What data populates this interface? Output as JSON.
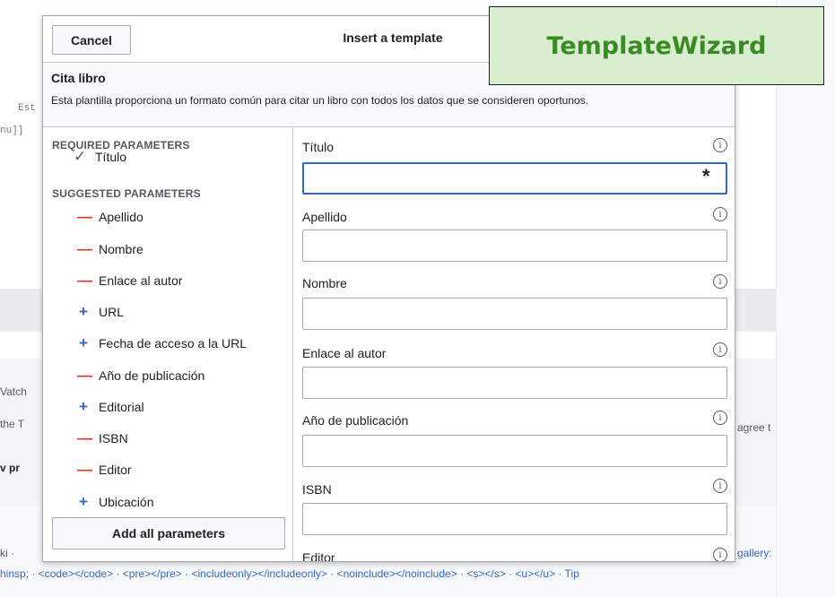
{
  "background": {
    "snippets": [
      {
        "text": "Est",
        "mono": true
      },
      {
        "text": "nu]]",
        "mono": true
      },
      {
        "text": "Vatch"
      },
      {
        "text": "the T"
      },
      {
        "text": "agree t"
      },
      {
        "text": "v pr",
        "bold": true
      },
      {
        "text": "ki ·"
      },
      {
        "text": "gallery:",
        "link": true
      },
      {
        "text": "hinsp; · <code></code> · <pre></pre> · <includeonly></includeonly> · <noinclude></noinclude> · <s></s> · <u></u> · Tip"
      }
    ]
  },
  "dialog": {
    "cancel_label": "Cancel",
    "title": "Insert a template"
  },
  "template": {
    "name": "Cita libro",
    "description": "Esta plantilla proporciona un formato común para citar un libro con todos los datos que se consideren oportunos."
  },
  "sidebar": {
    "required_header": "REQUIRED PARAMETERS",
    "required": [
      {
        "label": "Título",
        "icon": "check-icon"
      }
    ],
    "suggested_header": "SUGGESTED PARAMETERS",
    "suggested": [
      {
        "label": "Apellido",
        "icon": "remove-icon",
        "symbol": "—"
      },
      {
        "label": "Nombre",
        "icon": "remove-icon",
        "symbol": "—"
      },
      {
        "label": "Enlace al autor",
        "icon": "remove-icon",
        "symbol": "—"
      },
      {
        "label": "URL",
        "icon": "add-icon",
        "symbol": "+"
      },
      {
        "label": "Fecha de acceso a la URL",
        "icon": "add-icon",
        "symbol": "+"
      },
      {
        "label": "Año de publicación",
        "icon": "remove-icon",
        "symbol": "—"
      },
      {
        "label": "Editorial",
        "icon": "add-icon",
        "symbol": "+"
      },
      {
        "label": "ISBN",
        "icon": "remove-icon",
        "symbol": "—"
      },
      {
        "label": "Editor",
        "icon": "remove-icon",
        "symbol": "—"
      },
      {
        "label": "Ubicación",
        "icon": "add-icon",
        "symbol": "+"
      }
    ],
    "add_all_label": "Add all parameters"
  },
  "fields": [
    {
      "label": "Título",
      "value": "",
      "required": true,
      "focused": true
    },
    {
      "label": "Apellido",
      "value": ""
    },
    {
      "label": "Nombre",
      "value": ""
    },
    {
      "label": "Enlace al autor",
      "value": ""
    },
    {
      "label": "Año de publicación",
      "value": ""
    },
    {
      "label": "ISBN",
      "value": ""
    },
    {
      "label": "Editor",
      "value": ""
    }
  ],
  "required_marker": "*",
  "info_glyph": "i",
  "check_glyph": "✓",
  "banner": {
    "text": "TemplateWizard",
    "bg_color": "#d8eecf",
    "text_color": "#3a8a25"
  },
  "colors": {
    "remove": "#dd3333",
    "add": "#3366cc",
    "focus": "#3366cc"
  }
}
